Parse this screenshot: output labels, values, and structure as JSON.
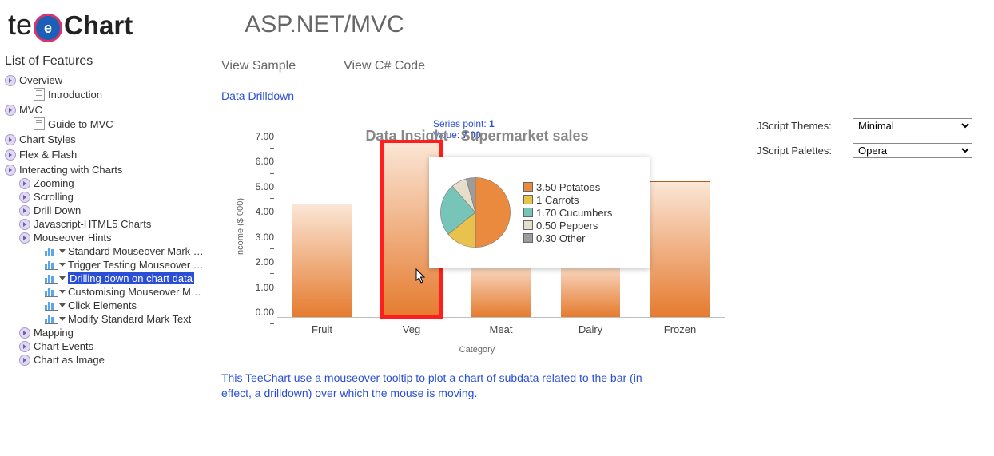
{
  "header": {
    "logo_prefix": "te",
    "logo_e": "e",
    "logo_suffix": "Chart",
    "page_title": "ASP.NET/MVC"
  },
  "sidebar": {
    "heading": "List of Features",
    "tree": [
      {
        "label": "Overview",
        "icon": "circle",
        "children": [
          {
            "label": "Introduction",
            "icon": "doc"
          }
        ]
      },
      {
        "label": "MVC",
        "icon": "circle",
        "children": [
          {
            "label": "Guide to MVC",
            "icon": "doc"
          }
        ]
      },
      {
        "label": "Chart Styles",
        "icon": "circle"
      },
      {
        "label": "Flex & Flash",
        "icon": "circle"
      },
      {
        "label": "Interacting with Charts",
        "icon": "circle",
        "children": [
          {
            "label": "Zooming",
            "icon": "circle"
          },
          {
            "label": "Scrolling",
            "icon": "circle"
          },
          {
            "label": "Drill Down",
            "icon": "circle"
          },
          {
            "label": "Javascript-HTML5 Charts",
            "icon": "circle"
          },
          {
            "label": "Mouseover Hints",
            "icon": "circle",
            "children": [
              {
                "label": "Standard Mouseover Mark Forma",
                "icon": "chart-thumb",
                "tri": true
              },
              {
                "label": "Trigger Testing Mouseover Marks",
                "icon": "chart-thumb",
                "tri": true
              },
              {
                "label": "Drilling down on chart data",
                "icon": "chart-thumb",
                "tri": true,
                "selected": true
              },
              {
                "label": "Customising Mouseover Marks",
                "icon": "chart-thumb",
                "tri": true
              },
              {
                "label": "Click Elements",
                "icon": "chart-thumb",
                "tri": true
              },
              {
                "label": "Modify Standard Mark Text",
                "icon": "chart-thumb",
                "tri": true
              }
            ]
          },
          {
            "label": "Mapping",
            "icon": "circle"
          },
          {
            "label": "Chart Events",
            "icon": "circle"
          },
          {
            "label": "Chart as Image",
            "icon": "circle"
          }
        ]
      }
    ]
  },
  "main": {
    "tabs": [
      "View Sample",
      "View C# Code"
    ],
    "subtitle": "Data Drilldown",
    "series_hint_label": "Series point:",
    "series_hint_point": "1",
    "series_hint_value_label": "Value:",
    "series_hint_value": "7.00",
    "controls": {
      "themes_label": "JScript Themes:",
      "themes_value": "Minimal",
      "palettes_label": "JScript Palettes:",
      "palettes_value": "Opera"
    },
    "description": "This TeeChart use a mouseover tooltip to plot a chart of subdata related to the bar (in effect, a drilldown) over which the mouse is moving."
  },
  "chart_data": {
    "type": "bar",
    "title": "Data Insight - Supermarket sales",
    "xlabel": "Category",
    "ylabel": "Income ($ 000)",
    "ylim": [
      0,
      7
    ],
    "yticks": [
      "0.00",
      "1.00",
      "2.00",
      "3.00",
      "4.00",
      "5.00",
      "6.00",
      "7.00"
    ],
    "categories": [
      "Fruit",
      "Veg",
      "Meat",
      "Dairy",
      "Frozen"
    ],
    "values": [
      4.5,
      7.0,
      2.3,
      2.3,
      5.4
    ],
    "highlighted_index": 1,
    "drilldown_pie": {
      "type": "pie",
      "for_category": "Veg",
      "series": [
        {
          "name": "Potatoes",
          "value": 3.5,
          "color": "#e98a3f"
        },
        {
          "name": "Carrots",
          "value": 1.0,
          "color": "#e8c24c"
        },
        {
          "name": "Cucumbers",
          "value": 1.7,
          "color": "#77c4b8"
        },
        {
          "name": "Peppers",
          "value": 0.5,
          "color": "#e6ddcb"
        },
        {
          "name": "Other",
          "value": 0.3,
          "color": "#9c9c9c"
        }
      ],
      "legend_labels": [
        "3.50 Potatoes",
        "1 Carrots",
        "1.70 Cucumbers",
        "0.50 Peppers",
        "0.30 Other"
      ]
    }
  }
}
